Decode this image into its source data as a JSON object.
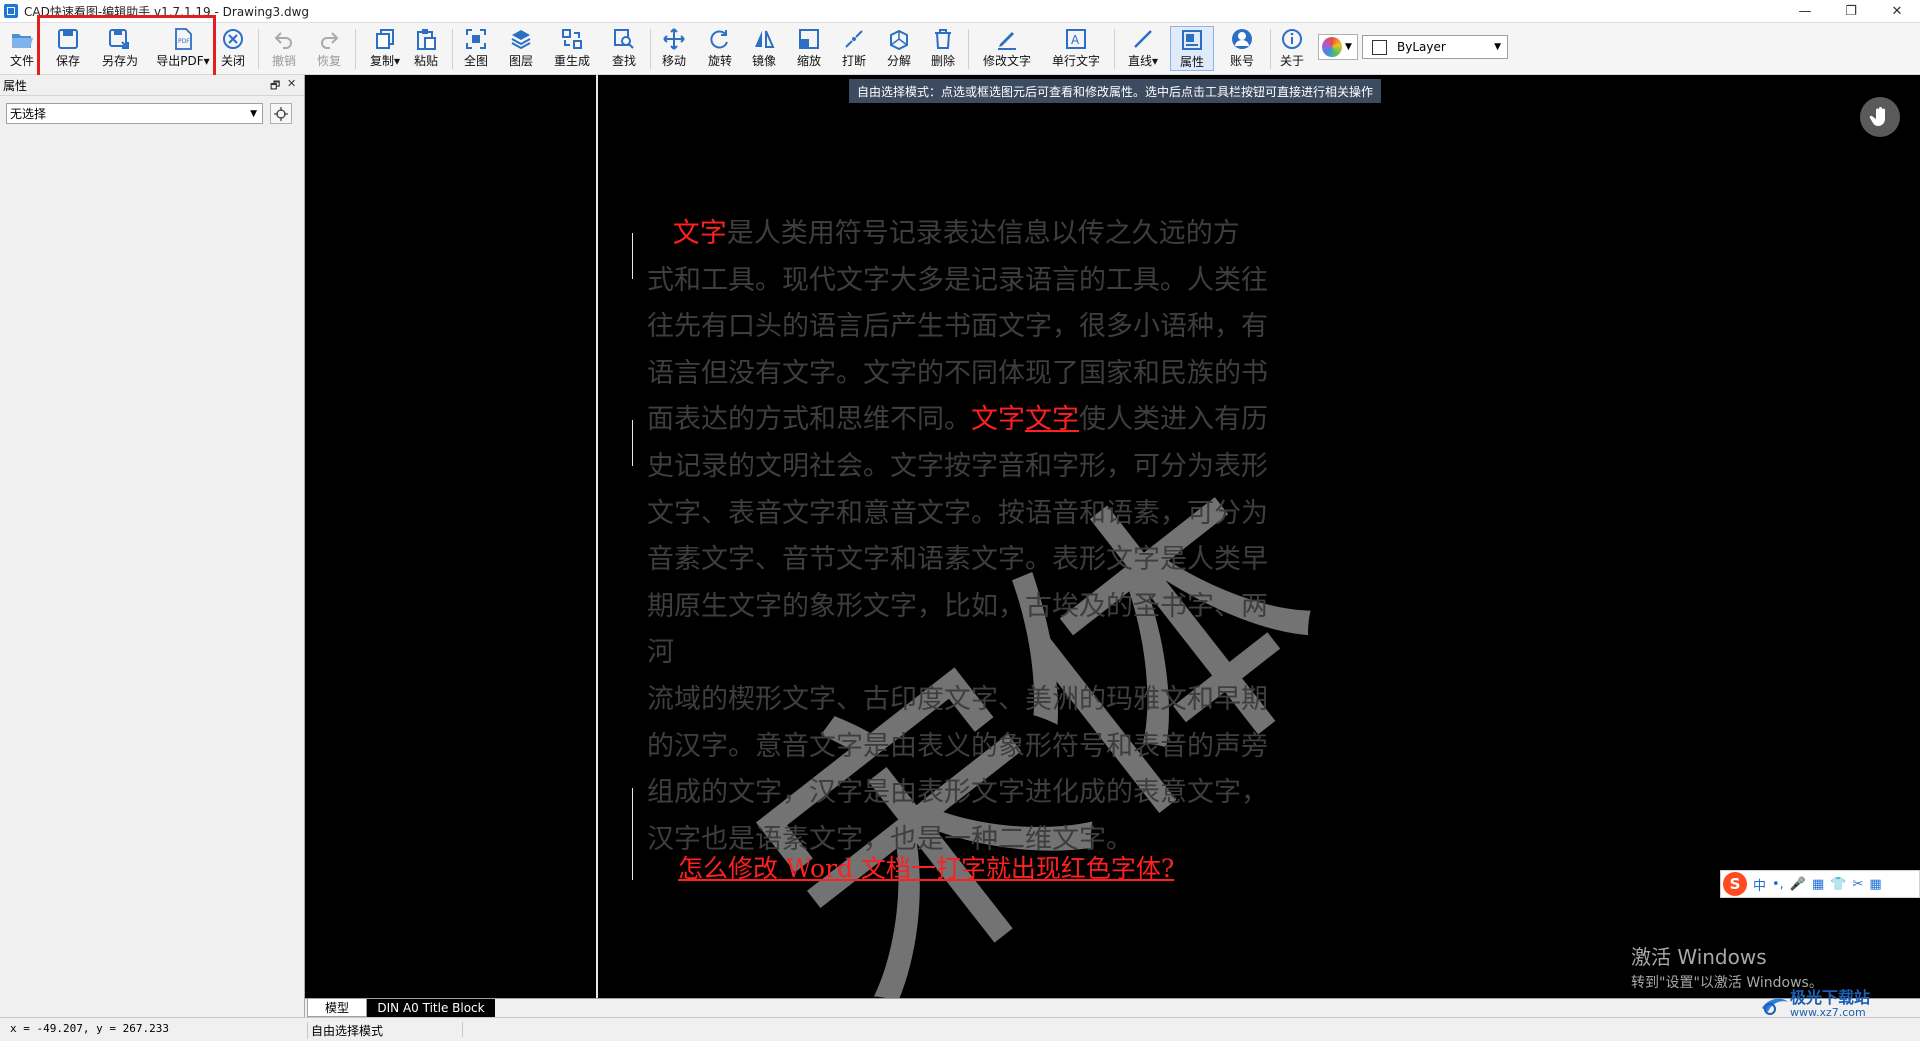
{
  "window": {
    "title": "CAD快速看图-编辑助手 v1.7.1.19 - Drawing3.dwg",
    "controls": [
      "—",
      "❐",
      "✕"
    ]
  },
  "toolbar": {
    "file": "文件",
    "save": "保存",
    "save_as": "另存为",
    "export_pdf": "导出PDF▾",
    "close": "关闭",
    "undo": "撤销",
    "redo": "恢复",
    "copy": "复制▾",
    "paste": "粘贴",
    "fit_all": "全图",
    "layers": "图层",
    "regen": "重生成",
    "find": "查找",
    "move": "移动",
    "rotate": "旋转",
    "mirror": "镜像",
    "scale": "缩放",
    "break": "打断",
    "explode": "分解",
    "delete": "删除",
    "edit_text": "修改文字",
    "single_text": "单行文字",
    "line": "直线▾",
    "properties": "属性",
    "account": "账号",
    "about": "关于",
    "layer_value": "ByLayer"
  },
  "panel": {
    "title": "属性",
    "pin": "🗗",
    "close": "✕",
    "selection": "无选择"
  },
  "canvas": {
    "tip": "自由选择模式：点选或框选图元后可查看和修改属性。选中后点击工具栏按钮可直接进行相关操作",
    "paragraph": {
      "red1": "文字",
      "line1": "是人类用符号记录表达信息以传之久远的方",
      "line2": "式和工具。现代文字大多是记录语言的工具。人类往",
      "line3": "往先有口头的语言后产生书面文字，很多小语种，有",
      "line4": "语言但没有文字。文字的不同体现了国家和民族的书",
      "line5a": "面表达的方式和思维不同。",
      "red2": "文字",
      "red3": "文字",
      "line5b": "使人类进入有历",
      "line6": "史记录的文明社会。文字按字音和字形，可分为表形",
      "line7": "文字、表音文字和意音文字。按语音和语素，可分为",
      "line8": "音素文字、音节文字和语素文字。表形文字是人类早",
      "line9": "期原生文字的象形文字，比如，古埃及的圣书字、两河",
      "line10": "流域的楔形文字、古印度文字、美洲的玛雅文和早期",
      "line11": "的汉字。意音文字是由表义的象形符号和表音的声旁",
      "line12": "组成的文字，汉字是由表形文字进化成的表意文字，",
      "line13": "汉字也是语素文字，也是一种二维文字。"
    },
    "red_title": "怎么修改 Word 文档一打字就出现红色字体?",
    "big_chars": "宋体",
    "watermark_line1": "激活 Windows",
    "watermark_line2": "转到\"设置\"以激活 Windows。"
  },
  "ime": {
    "logo": "S",
    "mode": "中",
    "items": [
      "•,",
      "🎤",
      "▦",
      "👕",
      "✂",
      "▦"
    ]
  },
  "tabs": [
    "模型",
    "DIN A0 Title Block"
  ],
  "status": {
    "coords": "x = -49.207,  y = 267.233",
    "mode": "自由选择模式"
  },
  "brand": {
    "name": "极光下载站",
    "url": "www.xz7.com"
  },
  "colors": {
    "highlight": "#e02020",
    "text_red": "#ff2020",
    "canvas": "#000000",
    "tip_bg": "#3d4b61"
  }
}
